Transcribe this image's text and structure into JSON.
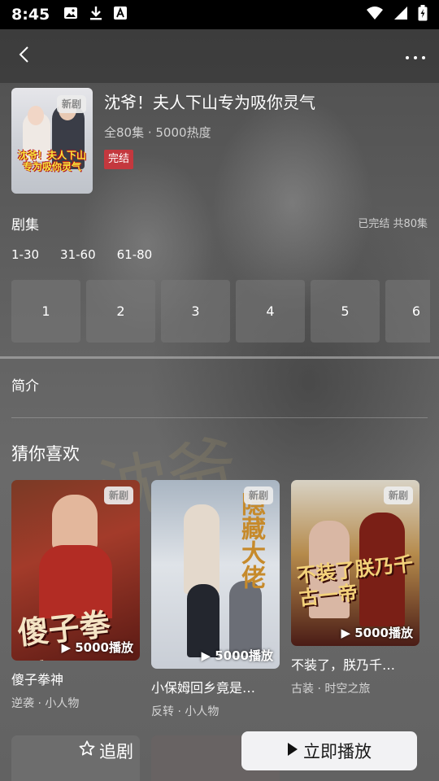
{
  "status_bar": {
    "time": "8:45",
    "icons_left": [
      "image-icon",
      "download-icon",
      "font-icon"
    ],
    "icons_right": [
      "wifi-icon",
      "signal-icon",
      "battery-icon"
    ]
  },
  "nav": {
    "back_icon": "chevron-left-icon",
    "more_icon": "more-horizontal-icon"
  },
  "drama": {
    "poster_badge": "新剧",
    "poster_title": "沈爷！夫人下山专为吸你灵气",
    "title": "沈爷！夫人下山专为吸你灵气",
    "meta": "全80集 · 5000热度",
    "status": "完结"
  },
  "episodes": {
    "section_title": "剧集",
    "summary": "已完结 共80集",
    "ranges": [
      "1-30",
      "31-60",
      "61-80"
    ],
    "items": [
      "1",
      "2",
      "3",
      "4",
      "5",
      "6"
    ]
  },
  "intro": {
    "section_title": "简介"
  },
  "recommend": {
    "section_title": "猜你喜欢",
    "items": [
      {
        "badge": "新剧",
        "plays": "5000播放",
        "title": "傻子拳神",
        "tags": "逆袭 · 小人物",
        "poster_text": "傻子拳神"
      },
      {
        "badge": "新剧",
        "plays": "5000播放",
        "title": "小保姆回乡竟是…",
        "tags": "反转 · 小人物",
        "poster_text": "隐藏大佬"
      },
      {
        "badge": "新剧",
        "plays": "5000播放",
        "title": "不装了，朕乃千…",
        "tags": "古装 · 时空之旅",
        "poster_text": "不装了朕乃千古一帝"
      }
    ]
  },
  "bottom": {
    "follow_label": "追剧",
    "play_label": "立即播放"
  }
}
